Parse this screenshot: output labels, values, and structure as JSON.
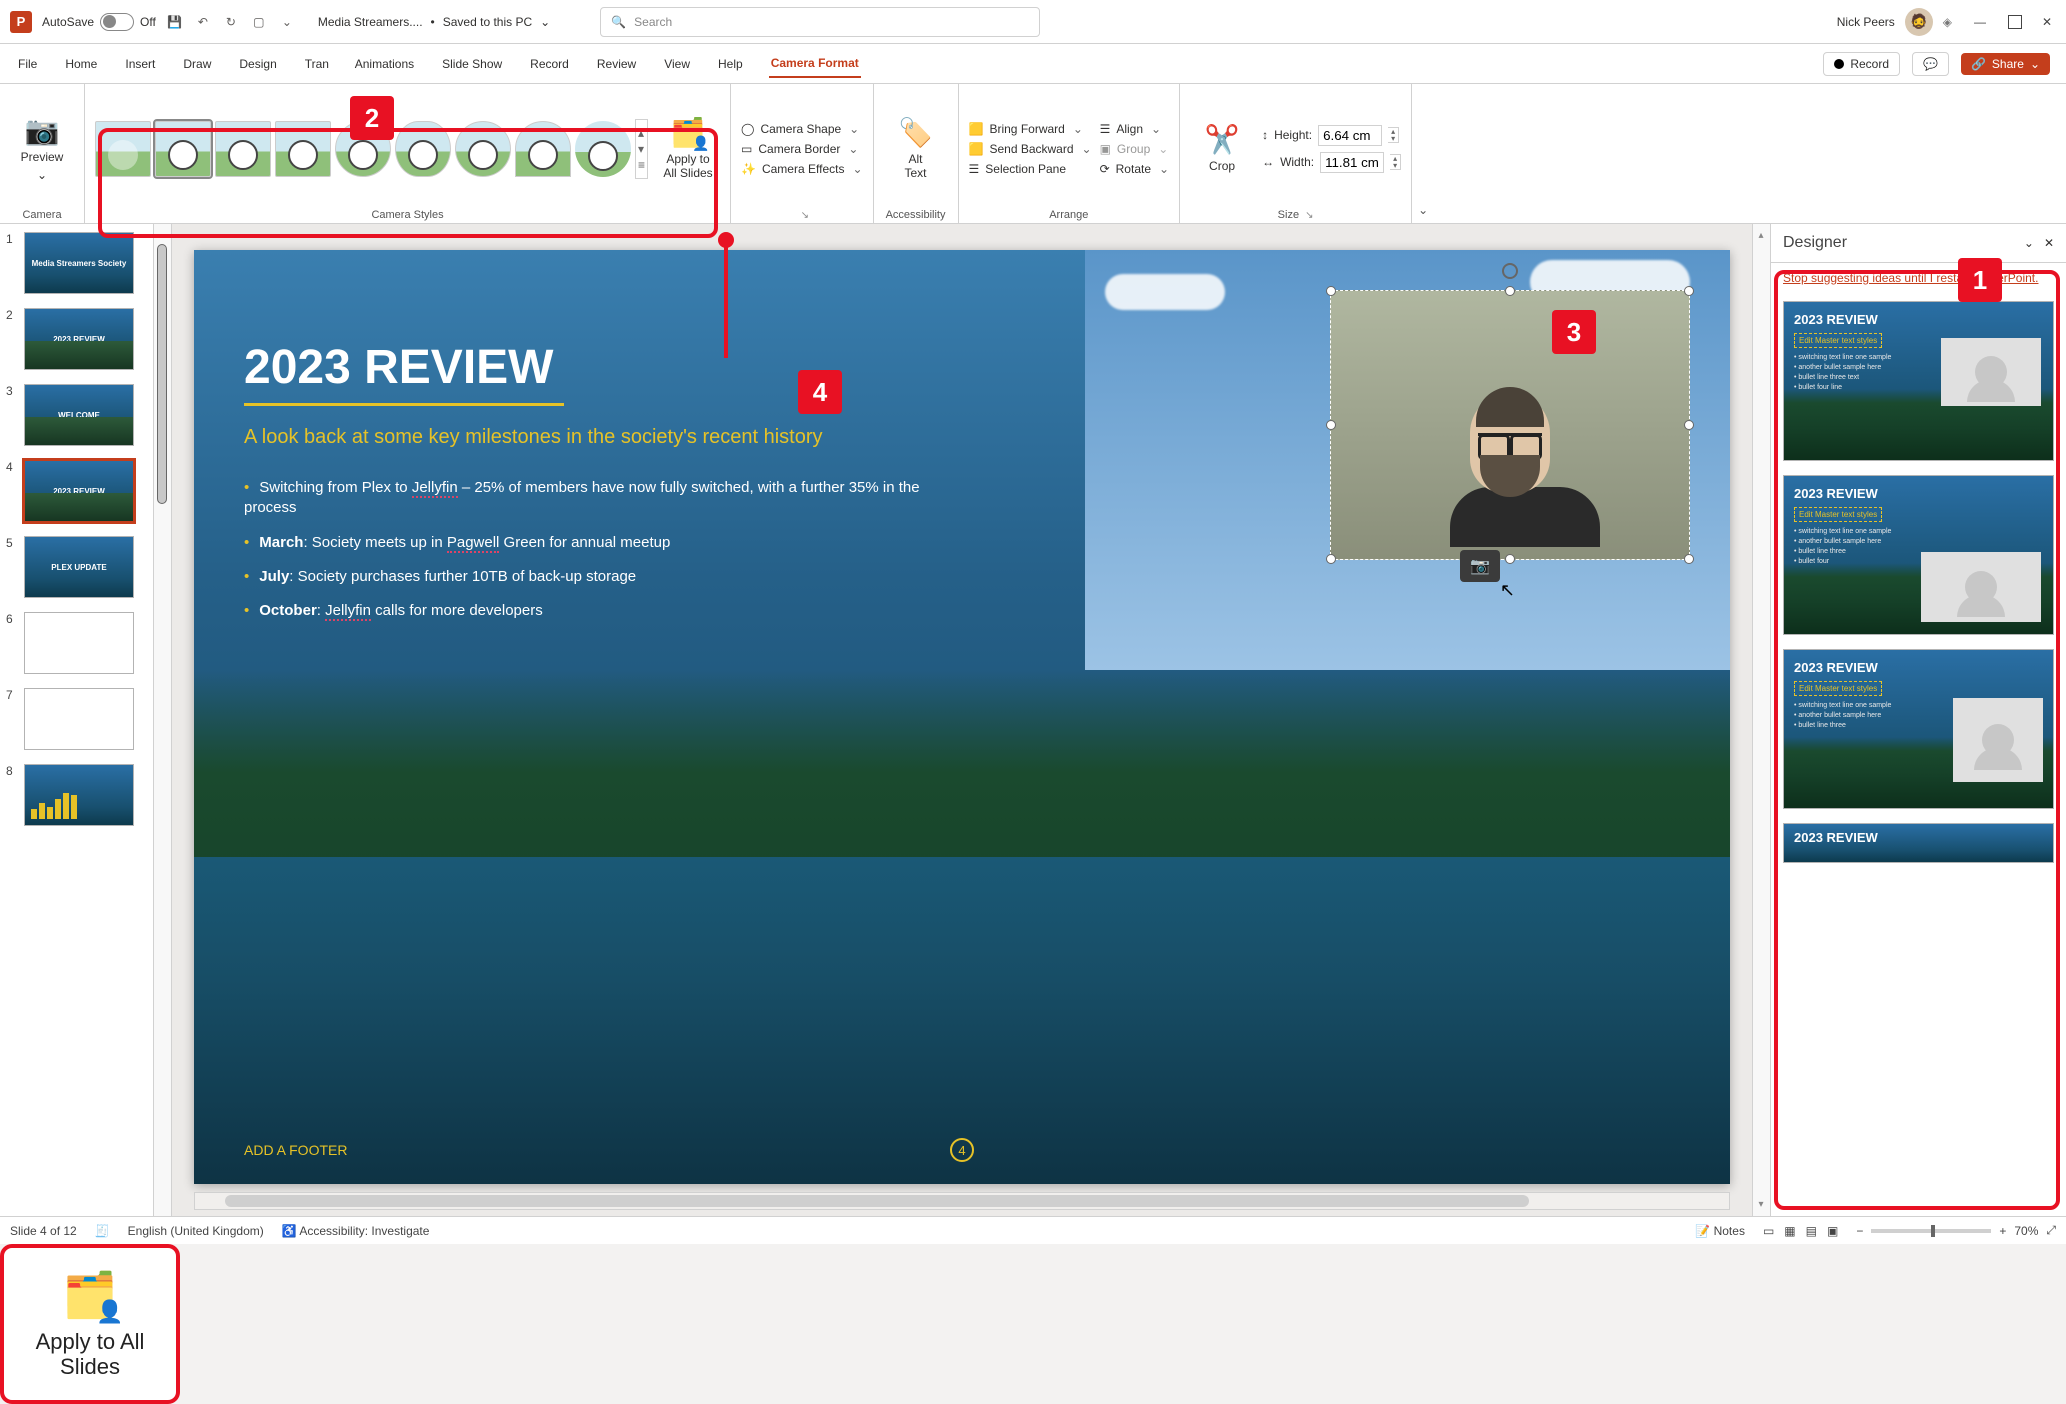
{
  "title_bar": {
    "autosave_label": "AutoSave",
    "autosave_state": "Off",
    "filename": "Media Streamers....",
    "save_status": "Saved to this PC",
    "search_placeholder": "Search",
    "user_name": "Nick Peers"
  },
  "tabs": {
    "items": [
      "File",
      "Home",
      "Insert",
      "Draw",
      "Design",
      "Transitions",
      "Animations",
      "Slide Show",
      "Record",
      "Review",
      "View",
      "Help",
      "Camera Format"
    ],
    "active": "Camera Format",
    "record_btn": "Record",
    "share_btn": "Share"
  },
  "ribbon": {
    "camera": {
      "preview": "Preview",
      "label": "Camera"
    },
    "styles": {
      "label": "Camera Styles",
      "apply_all": "Apply to\nAll Slides"
    },
    "shape": {
      "camera_shape": "Camera Shape",
      "camera_border": "Camera Border",
      "camera_effects": "Camera Effects"
    },
    "accessibility": {
      "alt_text": "Alt\nText",
      "label": "Accessibility"
    },
    "arrange": {
      "bring_forward": "Bring Forward",
      "send_backward": "Send Backward",
      "selection_pane": "Selection Pane",
      "align": "Align",
      "group": "Group",
      "rotate": "Rotate",
      "label": "Arrange"
    },
    "size": {
      "crop": "Crop",
      "height_label": "Height:",
      "height_value": "6.64 cm",
      "width_label": "Width:",
      "width_value": "11.81 cm",
      "label": "Size"
    }
  },
  "slide": {
    "title": "2023 REVIEW",
    "subtitle": "A look back at some key milestones in the society's recent history",
    "bullets": [
      "Switching from Plex to Jellyfin – 25% of members have now fully switched, with a further 35% in the process",
      "March: Society meets up in Pagwell Green for annual meetup",
      "July: Society purchases further 10TB of back-up storage",
      "October: Jellyfin calls for more developers"
    ],
    "footer": "ADD A FOOTER",
    "page_number": "4"
  },
  "thumbnails": {
    "count": 8,
    "selected": 4,
    "labels": [
      "Media Streamers Society",
      "2023 REVIEW",
      "WELCOME",
      "2023 REVIEW",
      "PLEX UPDATE",
      "",
      "",
      ""
    ]
  },
  "designer": {
    "title": "Designer",
    "stop_link": "Stop suggesting ideas until I restart PowerPoint.",
    "card_title": "2023 REVIEW",
    "card_sub": "Edit Master text styles"
  },
  "status": {
    "slide_counter": "Slide 4 of 12",
    "language": "English (United Kingdom)",
    "accessibility": "Accessibility: Investigate",
    "notes": "Notes",
    "zoom": "70%"
  },
  "callouts": {
    "n1": "1",
    "n2": "2",
    "n3": "3",
    "n4": "4",
    "apply_label": "Apply to All Slides"
  }
}
